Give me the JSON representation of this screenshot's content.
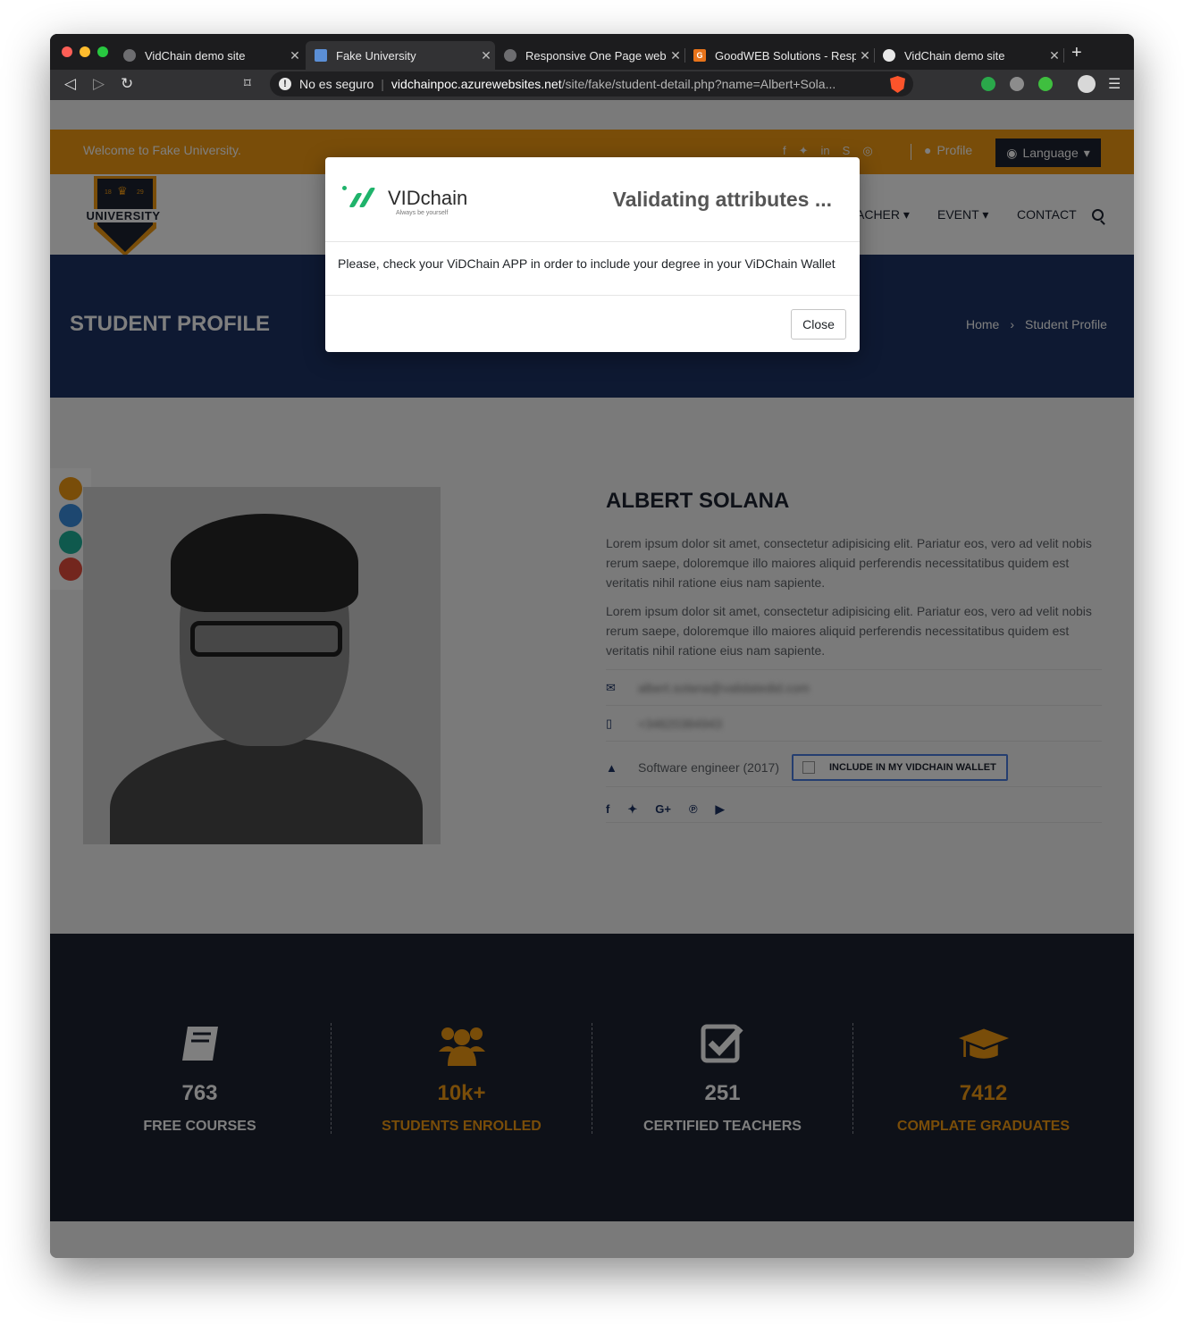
{
  "browser": {
    "tabs": [
      {
        "title": "VidChain demo site"
      },
      {
        "title": "Fake University"
      },
      {
        "title": "Responsive One Page webs"
      },
      {
        "title": "GoodWEB Solutions - Resp"
      },
      {
        "title": "VidChain demo site"
      }
    ],
    "security_label": "No es seguro",
    "url_host": "vidchainpoc.azurewebsites.net",
    "url_path": "/site/fake/student-detail.php?name=Albert+Sola...",
    "brave_badge": "1"
  },
  "topbar": {
    "welcome": "Welcome to Fake University.",
    "profile": "Profile",
    "language": "Language"
  },
  "logo": {
    "text": "UNIVERSITY",
    "year_left": "18",
    "year_right": "29"
  },
  "nav": {
    "teacher": "ACHER",
    "event": "EVENT",
    "contact": "CONTACT"
  },
  "hero": {
    "title": "STUDENT PROFILE",
    "crumb_home": "Home",
    "crumb_sep": "›",
    "crumb_current": "Student Profile"
  },
  "colors": {
    "orange": "#f39a12",
    "blue": "#3b8ee0",
    "teal": "#1fb39a",
    "red": "#e74c3c",
    "navy": "#1c3364",
    "dark": "#1d2330"
  },
  "student": {
    "name": "ALBERT SOLANA",
    "para1": "Lorem ipsum dolor sit amet, consectetur adipisicing elit. Pariatur eos, vero ad velit nobis rerum saepe, doloremque illo maiores aliquid perferendis necessitatibus quidem est veritatis nihil ratione eius nam sapiente.",
    "para2": "Lorem ipsum dolor sit amet, consectetur adipisicing elit. Pariatur eos, vero ad velit nobis rerum saepe, doloremque illo maiores aliquid perferendis necessitatibus quidem est veritatis nihil ratione eius nam sapiente.",
    "email": "albert.solana@validatedid.com",
    "phone": "+34620384943",
    "degree": "Software engineer (2017)",
    "wallet_button": "INCLUDE IN MY VIDCHAIN WALLET"
  },
  "stats": [
    {
      "value": "763",
      "label": "FREE COURSES",
      "icon": "book-icon"
    },
    {
      "value": "10k+",
      "label": "STUDENTS ENROLLED",
      "icon": "users-icon"
    },
    {
      "value": "251",
      "label": "CERTIFIED TEACHERS",
      "icon": "checkbox-icon"
    },
    {
      "value": "7412",
      "label": "COMPLATE GRADUATES",
      "icon": "graduation-cap-icon"
    }
  ],
  "modal": {
    "brand": "VIDchain",
    "tagline": "Always be yourself",
    "title": "Validating attributes ...",
    "body": "Please, check your ViDChain APP in order to include your degree in your ViDChain Wallet",
    "close": "Close"
  }
}
